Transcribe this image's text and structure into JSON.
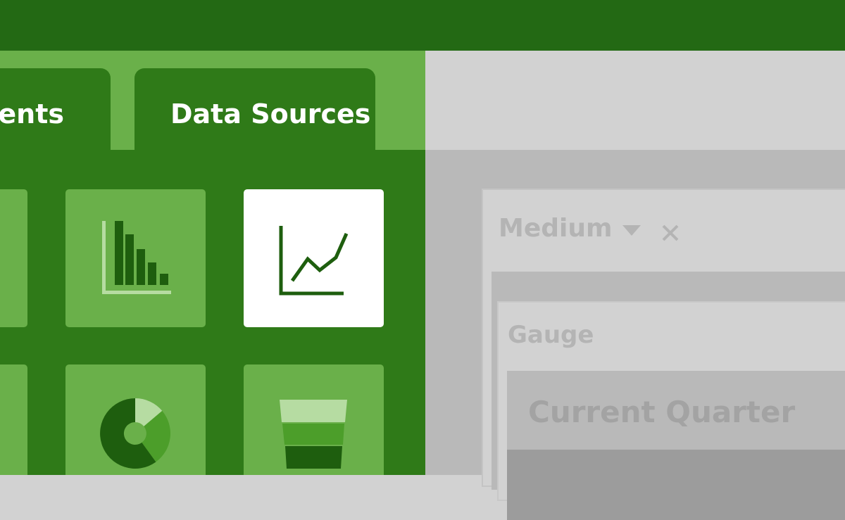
{
  "tabs": [
    {
      "label": "Components",
      "visible_text": "nents",
      "active": false
    },
    {
      "label": "Data Sources",
      "active": true
    }
  ],
  "tiles": [
    {
      "icon": "bar-chart-icon",
      "selected": false
    },
    {
      "icon": "line-chart-icon",
      "selected": true
    },
    {
      "icon": "donut-chart-icon",
      "selected": false
    },
    {
      "icon": "funnel-chart-icon",
      "selected": false
    }
  ],
  "properties": {
    "size_value": "Medium",
    "component_type": "Gauge",
    "title_value": "Current Quarter"
  },
  "colors": {
    "top_bar": "#236914",
    "panel_green": "#2f7a18",
    "tile_green": "#6ab04a",
    "icon_dark_green": "#1e5e0e",
    "icon_light_green": "#b6dca2",
    "pane_gray": "#d2d2d2",
    "pane_dark_gray": "#b9b9b9",
    "selected_tile": "#ffffff"
  }
}
